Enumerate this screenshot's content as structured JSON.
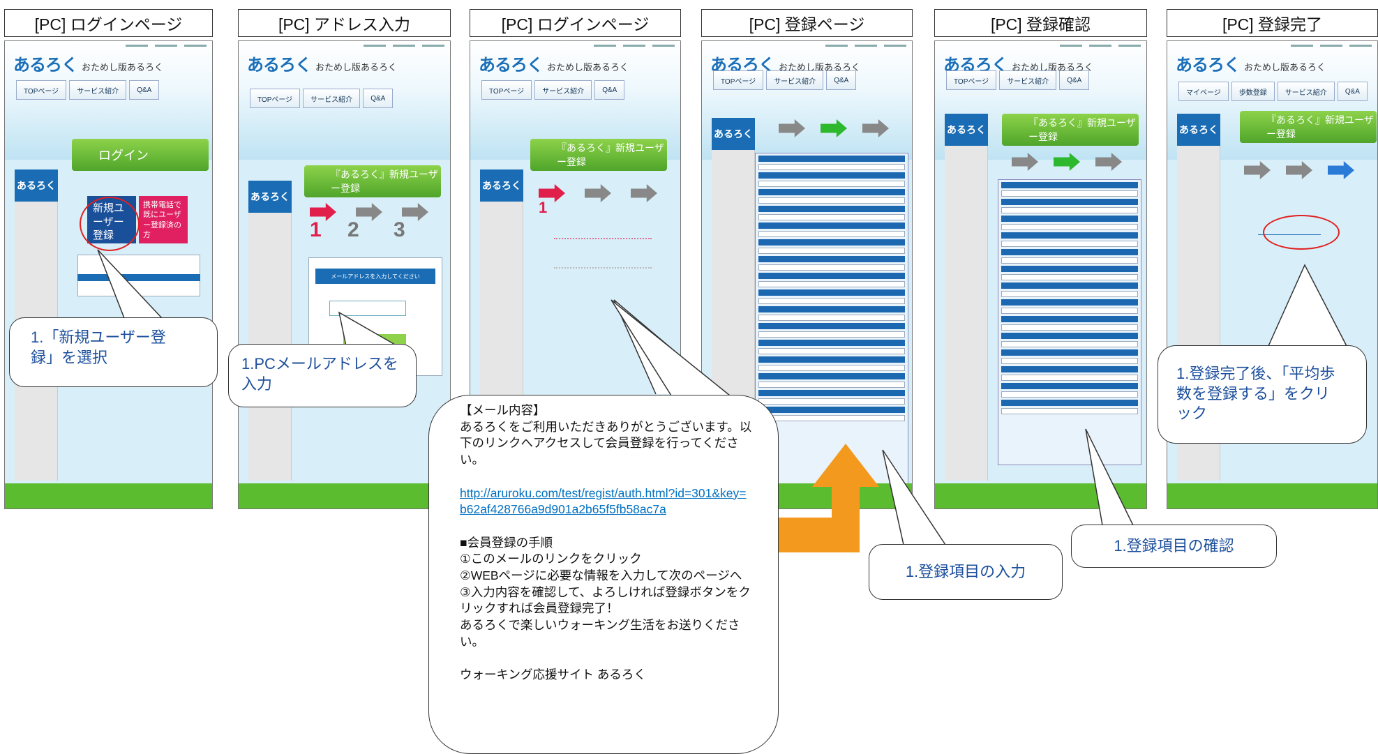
{
  "screens": [
    {
      "title": "[PC] ログインページ"
    },
    {
      "title": "[PC] アドレス入力"
    },
    {
      "title": "[PC] ログインページ"
    },
    {
      "title": "[PC] 登録ページ"
    },
    {
      "title": "[PC] 登録確認"
    },
    {
      "title": "[PC] 登録完了"
    }
  ],
  "site": {
    "logo": "あるろく",
    "subtitle": "おためし版あるろく",
    "nav": [
      "TOPページ",
      "サービス紹介",
      "Q&A"
    ],
    "nav_last": [
      "マイページ",
      "歩数登録",
      "サービス紹介",
      "Q&A"
    ],
    "login_heading": "ログイン",
    "new_user_button": "新規ユーザー登録",
    "mobile_button": "携帯電話で既にユーザー登録済の方",
    "register_heading": "『あるろく』新規ユーザー登録",
    "steps": [
      "1",
      "2",
      "3"
    ],
    "email_prompt": "メールアドレスを入力してください"
  },
  "callouts": {
    "c1": "1.「新規ユーザー登録」を選択",
    "c2": "1.PCメールアドレスを入力",
    "c4": "1.登録項目の入力",
    "c5": "1.登録項目の確認",
    "c6": "1.登録完了後、「平均歩数を登録する」をクリック"
  },
  "mail": {
    "heading": "【メール内容】",
    "body1": "あるろくをご利用いただきありがとうございます。以下のリンクへアクセスして会員登録を行ってください。",
    "link": "http://aruroku.com/test/regist/auth.html?id=301&key=b62af428766a9d901a2b65f5fb58ac7a",
    "steps_heading": "■会員登録の手順",
    "step1": "①このメールのリンクをクリック",
    "step2": "②WEBページに必要な情報を入力して次のページへ",
    "step3": "③入力内容を確認して、よろしければ登録ボタンをクリックすれば会員登録完了！",
    "closing": "あるろくで楽しいウォーキング生活をお送りください。",
    "signature": "ウォーキング応援サイト あるろく"
  },
  "colors": {
    "accent": "#1a6db5",
    "green": "#5cbc30",
    "red": "#e02020",
    "orange": "#f39a1e"
  }
}
